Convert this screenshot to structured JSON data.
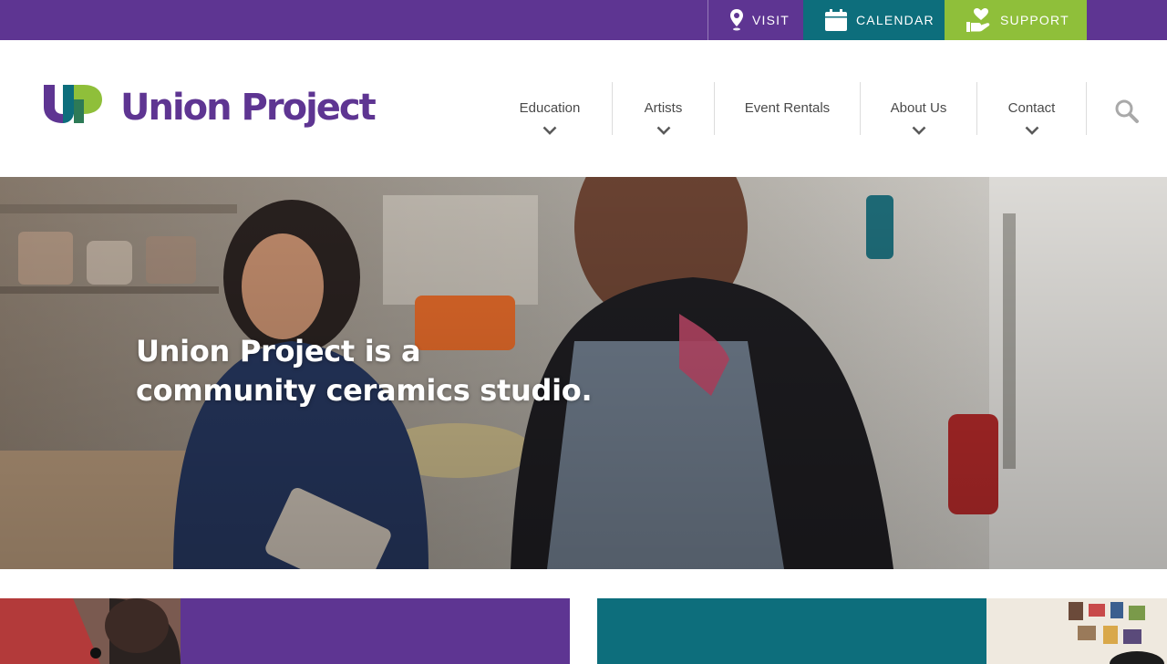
{
  "utility_bar": {
    "visit_label": "VISIT",
    "calendar_label": "CALENDAR",
    "support_label": "SUPPORT",
    "icons": {
      "visit": "map-pin-icon",
      "calendar": "calendar-icon",
      "support": "heart-hand-icon"
    }
  },
  "brand": {
    "name": "Union Project",
    "colors": {
      "purple": "#5e3592",
      "teal": "#0d6e7c",
      "green": "#8fbf3a"
    }
  },
  "nav": {
    "items": [
      {
        "label": "Education",
        "has_dropdown": true
      },
      {
        "label": "Artists",
        "has_dropdown": true
      },
      {
        "label": "Event Rentals",
        "has_dropdown": false
      },
      {
        "label": "About Us",
        "has_dropdown": true
      },
      {
        "label": "Contact",
        "has_dropdown": true
      }
    ],
    "search_icon": "search-icon"
  },
  "hero": {
    "title": "Union Project is a community ceramics studio."
  },
  "promo_cards": [
    {
      "heading": "",
      "color": "#5e3592"
    },
    {
      "heading": "",
      "color": "#0d6e7c"
    }
  ]
}
